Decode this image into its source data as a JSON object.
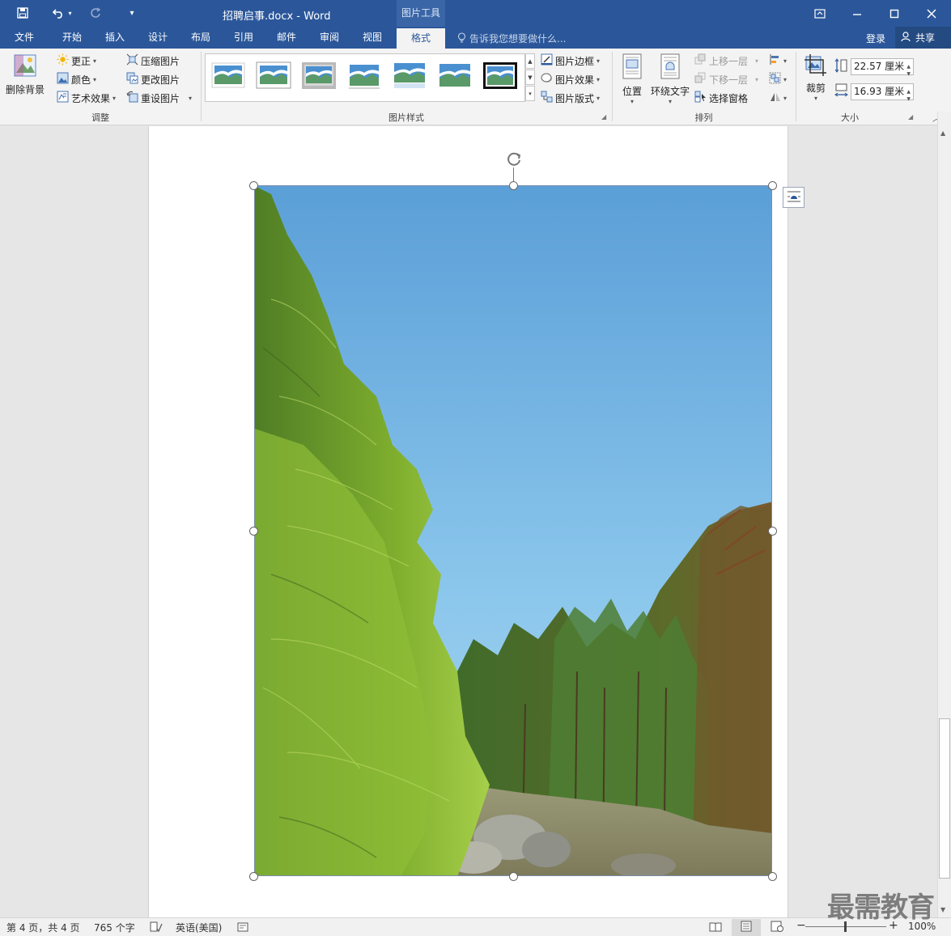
{
  "titlebar": {
    "title": "招聘启事.docx - Word",
    "context_tab": "图片工具",
    "customize_glyph": "▾"
  },
  "tabs": [
    {
      "label": "文件",
      "active": false
    },
    {
      "label": "开始",
      "active": false
    },
    {
      "label": "插入",
      "active": false
    },
    {
      "label": "设计",
      "active": false
    },
    {
      "label": "布局",
      "active": false
    },
    {
      "label": "引用",
      "active": false
    },
    {
      "label": "邮件",
      "active": false
    },
    {
      "label": "审阅",
      "active": false
    },
    {
      "label": "视图",
      "active": false
    },
    {
      "label": "格式",
      "active": true
    }
  ],
  "tell_me": "告诉我您想要做什么...",
  "account": {
    "login": "登录",
    "share": "共享"
  },
  "ribbon": {
    "adjust": {
      "label": "调整",
      "remove_background": "删除背景",
      "corrections": "更正",
      "color": "颜色",
      "artistic_effects": "艺术效果",
      "compress": "压缩图片",
      "change": "更改图片",
      "reset": "重设图片"
    },
    "styles": {
      "label": "图片样式",
      "border": "图片边框",
      "effects": "图片效果",
      "layout": "图片版式"
    },
    "arrange": {
      "label": "排列",
      "position": "位置",
      "wrap_text": "环绕文字",
      "bring_forward": "上移一层",
      "send_backward": "下移一层",
      "selection_pane": "选择窗格"
    },
    "size": {
      "label": "大小",
      "crop": "裁剪",
      "height": "22.57 厘米",
      "width": "16.93 厘米"
    }
  },
  "statusbar": {
    "page": "第 4 页，共 4 页",
    "words": "765 个字",
    "language": "英语(美国)",
    "zoom": "100%",
    "zoom_level": 1.0
  },
  "watermark": "最需教育",
  "colors": {
    "brand": "#2b579a",
    "ribbon_bg": "#f3f3f3",
    "canvas_bg": "#e6e6e6"
  }
}
